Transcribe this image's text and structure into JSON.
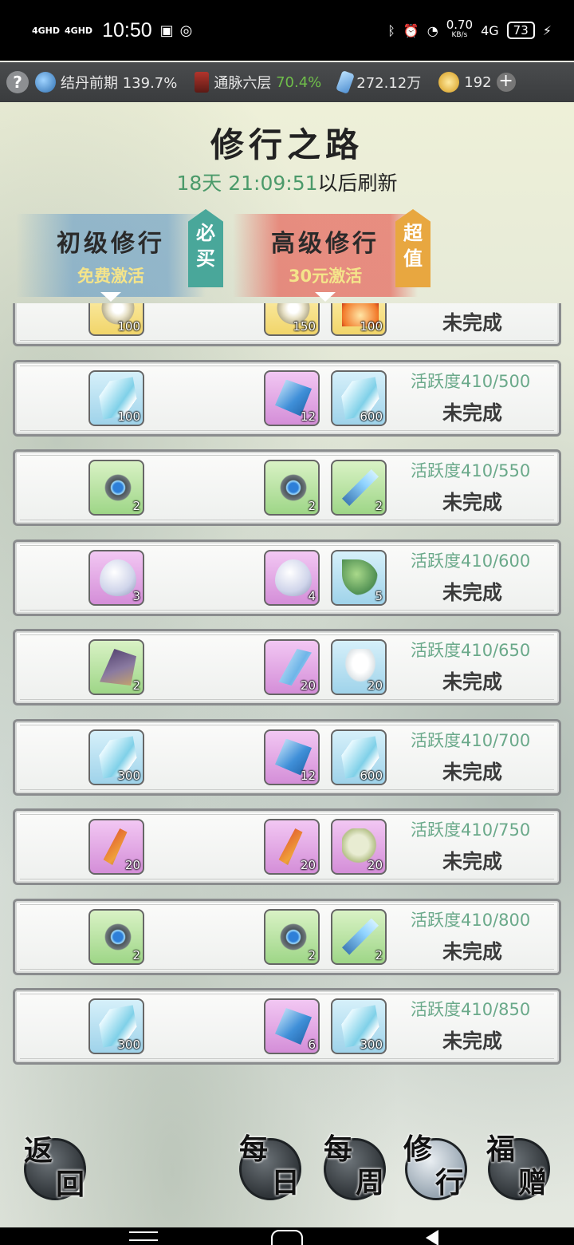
{
  "status_bar": {
    "net1": "4GHD",
    "net2": "4GHD",
    "time": "10:50",
    "speed": "0.70",
    "speed_unit": "KB/s",
    "net3": "4G",
    "battery": "73"
  },
  "resources": {
    "help": "?",
    "realm": "结丹前期 139.7%",
    "vein_label": "通脉六层",
    "vein_pct": "70.4%",
    "crystals": "272.12万",
    "coins": "192",
    "plus": "+"
  },
  "page": {
    "title": "修行之路",
    "countdown": "18天 21:09:51",
    "refresh_suffix": "以后刷新"
  },
  "tiers": {
    "basic": {
      "name": "初级修行",
      "sub": "免费激活",
      "badge": "必买"
    },
    "advanced": {
      "name": "高级修行",
      "sub": "30元激活",
      "badge": "超值"
    }
  },
  "rows": [
    {
      "a": {
        "icon": "scroll",
        "qty": "100"
      },
      "b": {
        "icon": "scroll",
        "qty": "150"
      },
      "c": {
        "icon": "flame",
        "qty": "100"
      },
      "req": "",
      "state": "未完成"
    },
    {
      "a": {
        "icon": "paper",
        "qty": "100"
      },
      "b": {
        "icon": "crystal",
        "qty": "12"
      },
      "c": {
        "icon": "paper",
        "qty": "600"
      },
      "req": "活跃度410/500",
      "state": "未完成"
    },
    {
      "a": {
        "icon": "ring",
        "qty": "2"
      },
      "b": {
        "icon": "ring",
        "qty": "2"
      },
      "c": {
        "icon": "feather",
        "qty": "2"
      },
      "req": "活跃度410/550",
      "state": "未完成"
    },
    {
      "a": {
        "icon": "egg",
        "qty": "3"
      },
      "b": {
        "icon": "egg",
        "qty": "4"
      },
      "c": {
        "icon": "leaf",
        "qty": "5"
      },
      "req": "活跃度410/600",
      "state": "未完成"
    },
    {
      "a": {
        "icon": "cloak",
        "qty": "2"
      },
      "b": {
        "icon": "blade",
        "qty": "20"
      },
      "c": {
        "icon": "bowl",
        "qty": "20"
      },
      "req": "活跃度410/650",
      "state": "未完成"
    },
    {
      "a": {
        "icon": "paper",
        "qty": "300"
      },
      "b": {
        "icon": "crystal",
        "qty": "12"
      },
      "c": {
        "icon": "paper",
        "qty": "600"
      },
      "req": "活跃度410/700",
      "state": "未完成"
    },
    {
      "a": {
        "icon": "brush",
        "qty": "20"
      },
      "b": {
        "icon": "brush",
        "qty": "20"
      },
      "c": {
        "icon": "fish",
        "qty": "20"
      },
      "req": "活跃度410/750",
      "state": "未完成"
    },
    {
      "a": {
        "icon": "ring",
        "qty": "2"
      },
      "b": {
        "icon": "ring",
        "qty": "2"
      },
      "c": {
        "icon": "feather",
        "qty": "2"
      },
      "req": "活跃度410/800",
      "state": "未完成"
    },
    {
      "a": {
        "icon": "paper",
        "qty": "300"
      },
      "b": {
        "icon": "crystal",
        "qty": "6"
      },
      "c": {
        "icon": "paper",
        "qty": "300"
      },
      "req": "活跃度410/850",
      "state": "未完成"
    }
  ],
  "nav": {
    "back": [
      "返",
      "回"
    ],
    "daily": [
      "每",
      "日"
    ],
    "weekly": [
      "每",
      "周"
    ],
    "practice": [
      "修",
      "行"
    ],
    "gift": [
      "福",
      "赠"
    ]
  }
}
